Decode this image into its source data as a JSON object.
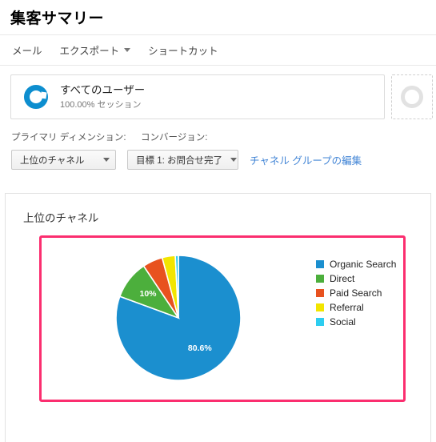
{
  "header": {
    "title": "集客サマリー"
  },
  "toolbar": {
    "items": [
      {
        "label": "メール",
        "icon": "",
        "has_caret": false
      },
      {
        "label": "エクスポート",
        "icon": "chevron-down-icon",
        "has_caret": true
      },
      {
        "label": "ショートカット",
        "icon": "",
        "has_caret": false
      }
    ]
  },
  "segment": {
    "name": "すべてのユーザー",
    "sub": "100.00% セッション",
    "donut_color": "#0d8ecf",
    "add_segment_donut_color": "#e2e2e2"
  },
  "dimensions": {
    "primary_label": "プライマリ ディメンション:",
    "conversion_label": "コンバージョン:",
    "primary_value": "上位のチャネル",
    "conversion_value": "目標 1: お問合せ完了",
    "edit_link": "チャネル グループの編集",
    "link_color": "#4285d6"
  },
  "chart_card": {
    "title": "上位のチャネル",
    "highlight_color": "#fb2e6f"
  },
  "chart_data": {
    "type": "pie",
    "title": "上位のチャネル",
    "categories": [
      "Organic Search",
      "Direct",
      "Paid Search",
      "Referral",
      "Social"
    ],
    "values": [
      80.6,
      10.0,
      5.2,
      3.4,
      0.8
    ],
    "colors": [
      "#1b8fcf",
      "#4caf3c",
      "#e8521f",
      "#f2e500",
      "#2dcdf0"
    ],
    "data_labels": [
      {
        "category": "Organic Search",
        "text": "80.6%",
        "shown": true
      },
      {
        "category": "Direct",
        "text": "10%",
        "shown": true
      },
      {
        "category": "Paid Search",
        "text": "",
        "shown": false
      },
      {
        "category": "Referral",
        "text": "",
        "shown": false
      },
      {
        "category": "Social",
        "text": "",
        "shown": false
      }
    ],
    "legend_position": "right",
    "start_angle_deg": 0,
    "direction": "clockwise",
    "units": "percent"
  }
}
